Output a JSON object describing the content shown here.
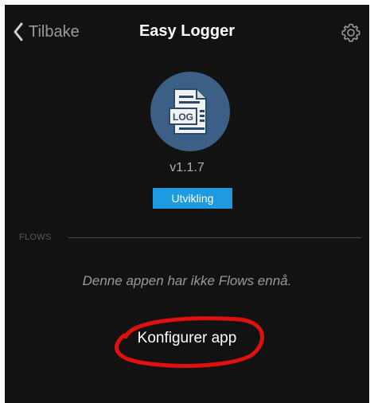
{
  "navbar": {
    "back_label": "Tilbake",
    "title": "Easy Logger",
    "back_icon": "chevron-left-icon",
    "settings_icon": "gear-icon"
  },
  "app": {
    "icon": "log-file-icon",
    "icon_text": "LOG",
    "version": "v1.1.7",
    "badge": "Utvikling"
  },
  "flows": {
    "section_label": "FLOWS",
    "empty_message": "Denne appen har ikke Flows ennå."
  },
  "actions": {
    "configure_label": "Konfigurer app"
  },
  "colors": {
    "background": "#121212",
    "app_icon_bg": "#3c5f86",
    "badge_bg": "#1e9be0",
    "annotation": "#e01010"
  }
}
